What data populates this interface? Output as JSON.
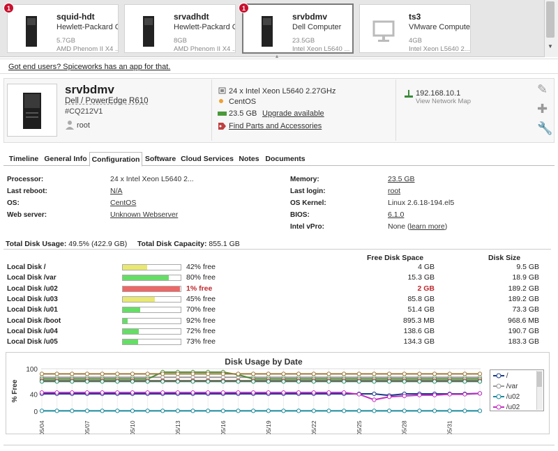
{
  "devices": [
    {
      "name": "squid-hdt",
      "sub": "Hewlett-Packard C...",
      "mem": "5.7GB",
      "cpu": "AMD Phenom II X4 ...",
      "badge": "1"
    },
    {
      "name": "srvadhdt",
      "sub": "Hewlett-Packard C...",
      "mem": "8GB",
      "cpu": "AMD Phenom II X4 ...",
      "badge": ""
    },
    {
      "name": "srvbdmv",
      "sub": "Dell Computer",
      "mem": "23.5GB",
      "cpu": "Intel Xeon L5640 ...",
      "badge": "1"
    },
    {
      "name": "ts3",
      "sub": "VMware Computer",
      "mem": "4GB",
      "cpu": "Intel Xeon L5640 2...",
      "badge": ""
    }
  ],
  "promo": "Got end users? Spiceworks has an app for that.",
  "device": {
    "name": "srvbdmv",
    "model": "Dell / PowerEdge R610",
    "tag": "#CQ212V1",
    "user": "root",
    "cpu": "24 x Intel Xeon L5640 2.27GHz",
    "os": "CentOS",
    "memory": "23.5 GB",
    "upgrade": "Upgrade available",
    "parts": "Find Parts and Accessories",
    "ip": "192.168.10.1",
    "netmap": "View Network Map"
  },
  "tabs": [
    "Timeline",
    "General Info",
    "Configuration",
    "Software",
    "Cloud Services",
    "Notes",
    "Documents"
  ],
  "config": {
    "processor_label": "Processor:",
    "processor": "24 x Intel Xeon L5640 2...",
    "reboot_label": "Last reboot:",
    "reboot": "N/A",
    "os_label": "OS:",
    "os": "CentOS",
    "web_label": "Web server:",
    "web": "Unknown Webserver",
    "memory_label": "Memory:",
    "memory": "23.5 GB",
    "login_label": "Last login:",
    "login": "root",
    "kernel_label": "OS Kernel:",
    "kernel": "Linux 2.6.18-194.el5",
    "bios_label": "BIOS:",
    "bios": "6.1.0",
    "vpro_label": "Intel  vPro:",
    "vpro": "None",
    "vpro_link": "learn more"
  },
  "usage": {
    "total_usage_label": "Total Disk Usage:",
    "total_usage": "49.5% (422.9 GB)",
    "total_capacity_label": "Total Disk Capacity:",
    "total_capacity": "855.1 GB"
  },
  "disk_headers": {
    "free": "Free Disk Space",
    "size": "Disk Size"
  },
  "disks": [
    {
      "name": "Local Disk /",
      "pct": 42,
      "pct_label": "42% free",
      "free": "4 GB",
      "size": "9.5 GB",
      "color": "#e8e872",
      "warn": false
    },
    {
      "name": "Local Disk /var",
      "pct": 80,
      "pct_label": "80% free",
      "free": "15.3 GB",
      "size": "18.9 GB",
      "color": "#66dd66",
      "warn": false
    },
    {
      "name": "Local Disk /u02",
      "pct": 99,
      "pct_label": "1% free",
      "free": "2 GB",
      "size": "189.2 GB",
      "color": "#ee6666",
      "warn": true
    },
    {
      "name": "Local Disk /u03",
      "pct": 55,
      "pct_label": "45% free",
      "free": "85.8 GB",
      "size": "189.2 GB",
      "color": "#e8e872",
      "warn": false
    },
    {
      "name": "Local Disk /u01",
      "pct": 30,
      "pct_label": "70% free",
      "free": "51.4 GB",
      "size": "73.3 GB",
      "color": "#66dd66",
      "warn": false
    },
    {
      "name": "Local Disk /boot",
      "pct": 8,
      "pct_label": "92% free",
      "free": "895.3 MB",
      "size": "968.6 MB",
      "color": "#66dd66",
      "warn": false
    },
    {
      "name": "Local Disk /u04",
      "pct": 28,
      "pct_label": "72% free",
      "free": "138.6 GB",
      "size": "190.7 GB",
      "color": "#66dd66",
      "warn": false
    },
    {
      "name": "Local Disk /u05",
      "pct": 27,
      "pct_label": "73% free",
      "free": "134.3 GB",
      "size": "183.3 GB",
      "color": "#66dd66",
      "warn": false
    }
  ],
  "chart_data": {
    "type": "line",
    "title": "Disk Usage by Date",
    "ylabel": "% Free",
    "xlabel": "",
    "ylim": [
      0,
      100
    ],
    "yticks": [
      0,
      40,
      100
    ],
    "x": [
      "05/04",
      "05/05",
      "05/06",
      "05/07",
      "05/08",
      "05/09",
      "05/10",
      "05/11",
      "05/12",
      "05/13",
      "05/14",
      "05/15",
      "05/16",
      "05/17",
      "05/18",
      "05/19",
      "05/20",
      "05/21",
      "05/22",
      "05/23",
      "05/24",
      "05/25",
      "05/26",
      "05/27",
      "05/28",
      "05/29",
      "05/30",
      "05/31",
      "06/01",
      "06/02"
    ],
    "xtick_labels": [
      "05/04",
      "05/07",
      "05/10",
      "05/13",
      "05/16",
      "05/19",
      "05/22",
      "05/25",
      "05/28",
      "05/31"
    ],
    "legend_position": "right",
    "series": [
      {
        "name": "/",
        "color": "#1a3a8c",
        "values": [
          41,
          41,
          41,
          41,
          41,
          41,
          41,
          41,
          41,
          41,
          41,
          41,
          41,
          41,
          41,
          41,
          41,
          41,
          41,
          41,
          41,
          41,
          41,
          37,
          41,
          41,
          41,
          41,
          41,
          42
        ]
      },
      {
        "name": "/var",
        "color": "#999999",
        "values": [
          80,
          80,
          80,
          80,
          80,
          80,
          80,
          80,
          80,
          80,
          80,
          80,
          80,
          80,
          80,
          80,
          80,
          80,
          80,
          80,
          80,
          80,
          80,
          80,
          80,
          80,
          80,
          80,
          80,
          80
        ]
      },
      {
        "name": "/u02",
        "color": "#1a8a9c",
        "values": [
          1,
          1,
          1,
          1,
          1,
          1,
          1,
          1,
          1,
          1,
          1,
          1,
          1,
          1,
          1,
          1,
          1,
          1,
          1,
          1,
          1,
          1,
          1,
          1,
          1,
          1,
          1,
          1,
          1,
          1
        ]
      },
      {
        "name": "/u02",
        "color": "#c030c0",
        "values": [
          44,
          44,
          44,
          44,
          44,
          44,
          44,
          44,
          44,
          44,
          44,
          44,
          44,
          44,
          44,
          44,
          44,
          44,
          44,
          44,
          44,
          40,
          27,
          34,
          36,
          38,
          38,
          40,
          40,
          42
        ]
      },
      {
        "name": "",
        "color": "#4a8a3a",
        "values": [
          76,
          76,
          76,
          76,
          76,
          76,
          76,
          76,
          92,
          92,
          92,
          92,
          92,
          86,
          76,
          76,
          76,
          76,
          76,
          76,
          76,
          76,
          76,
          76,
          76,
          76,
          76,
          76,
          76,
          76
        ]
      },
      {
        "name": "",
        "color": "#c44040",
        "values": [
          72,
          72,
          72,
          72,
          72,
          72,
          72,
          72,
          72,
          72,
          72,
          72,
          72,
          72,
          72,
          72,
          72,
          72,
          72,
          72,
          72,
          72,
          72,
          72,
          72,
          72,
          72,
          72,
          72,
          72
        ]
      },
      {
        "name": "",
        "color": "#a07a3a",
        "values": [
          88,
          88,
          88,
          88,
          88,
          88,
          88,
          88,
          88,
          88,
          88,
          88,
          88,
          88,
          88,
          88,
          88,
          88,
          88,
          88,
          88,
          88,
          88,
          88,
          88,
          88,
          88,
          88,
          88,
          88
        ]
      },
      {
        "name": "",
        "color": "#2a8a6a",
        "values": [
          70,
          70,
          70,
          70,
          70,
          70,
          70,
          70,
          70,
          70,
          70,
          70,
          70,
          70,
          70,
          70,
          70,
          70,
          70,
          70,
          70,
          70,
          70,
          70,
          70,
          70,
          70,
          70,
          70,
          70
        ]
      }
    ]
  },
  "legend": [
    {
      "label": "/",
      "color": "#1a3a8c"
    },
    {
      "label": "/var",
      "color": "#999999"
    },
    {
      "label": "/u02",
      "color": "#1a8a9c"
    },
    {
      "label": "/u02",
      "color": "#c030c0"
    }
  ]
}
